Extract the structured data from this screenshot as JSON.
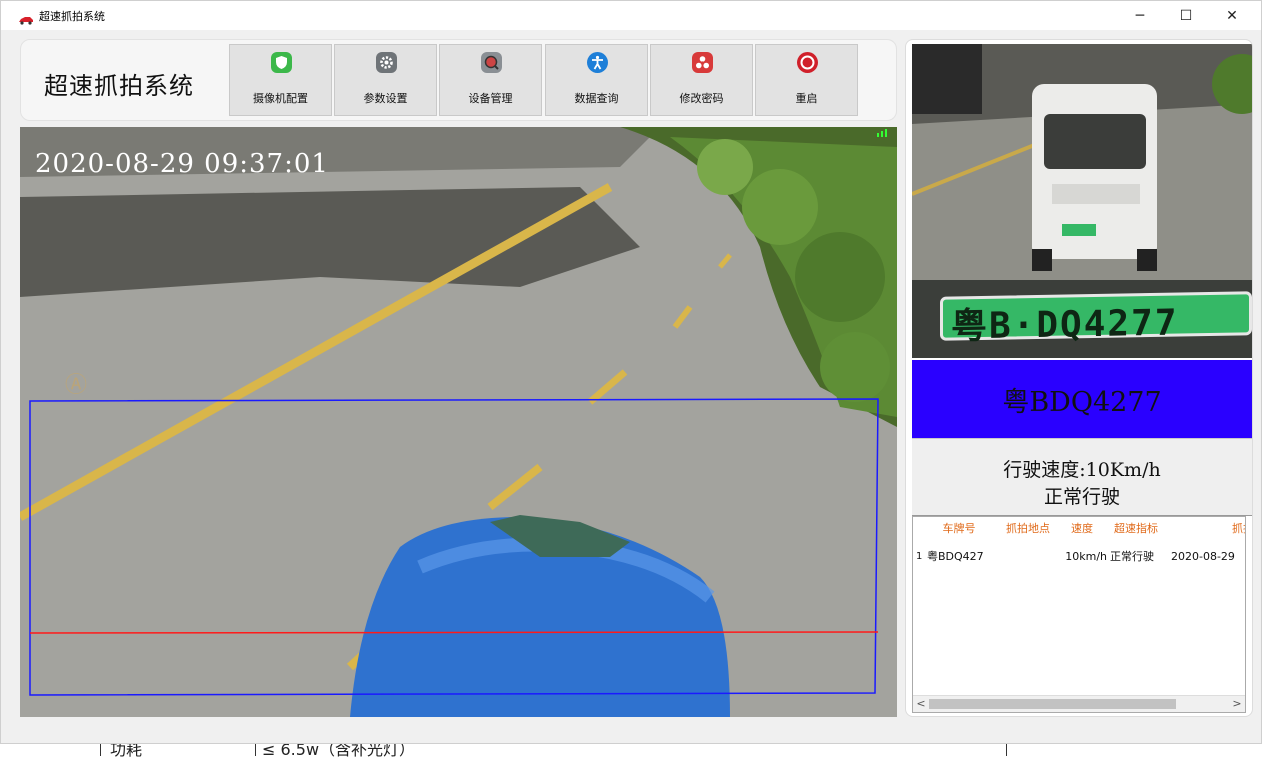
{
  "window": {
    "title": "超速抓拍系统",
    "controls": {
      "minimize": "─",
      "maximize": "☐",
      "close": "✕"
    }
  },
  "toolbar": {
    "system_title": "超速抓拍系统",
    "buttons": [
      {
        "label": "摄像机配置",
        "icon": "shield-icon",
        "color": "#3cb84a"
      },
      {
        "label": "参数设置",
        "icon": "gear-icon",
        "color": "#6f7478"
      },
      {
        "label": "设备管理",
        "icon": "search-icon",
        "color": "#8a8f94"
      },
      {
        "label": "数据查询",
        "icon": "accessibility-icon",
        "color": "#1e7fd8"
      },
      {
        "label": "修改密码",
        "icon": "key-icon",
        "color": "#d83a3a"
      },
      {
        "label": "重启",
        "icon": "power-icon",
        "color": "#d0202a"
      }
    ]
  },
  "video": {
    "timestamp": "2020-08-29 09:37:01",
    "colors": {
      "detection_zone": "#1a1aff",
      "trigger_line": "#ff1a1a"
    }
  },
  "capture": {
    "plate_image_text": "粤B·DQ4277",
    "plate_number": "粤BDQ4277",
    "speed_text": "行驶速度:10Km/h",
    "status_text": "正常行驶",
    "plate_box_color": "#2a00ff"
  },
  "records": {
    "columns": [
      "",
      "车牌号",
      "抓拍地点",
      "速度",
      "超速指标",
      "抓拍时"
    ],
    "rows": [
      [
        "1",
        "粤BDQ427",
        "",
        "10km/h",
        "正常行驶",
        "2020-08-29"
      ]
    ],
    "header_color": "#e06a1a",
    "scroll_left": "<",
    "scroll_right": ">"
  },
  "background_doc": {
    "col1": "功耗",
    "col2": "≤ 6.5w（含补光灯）"
  }
}
